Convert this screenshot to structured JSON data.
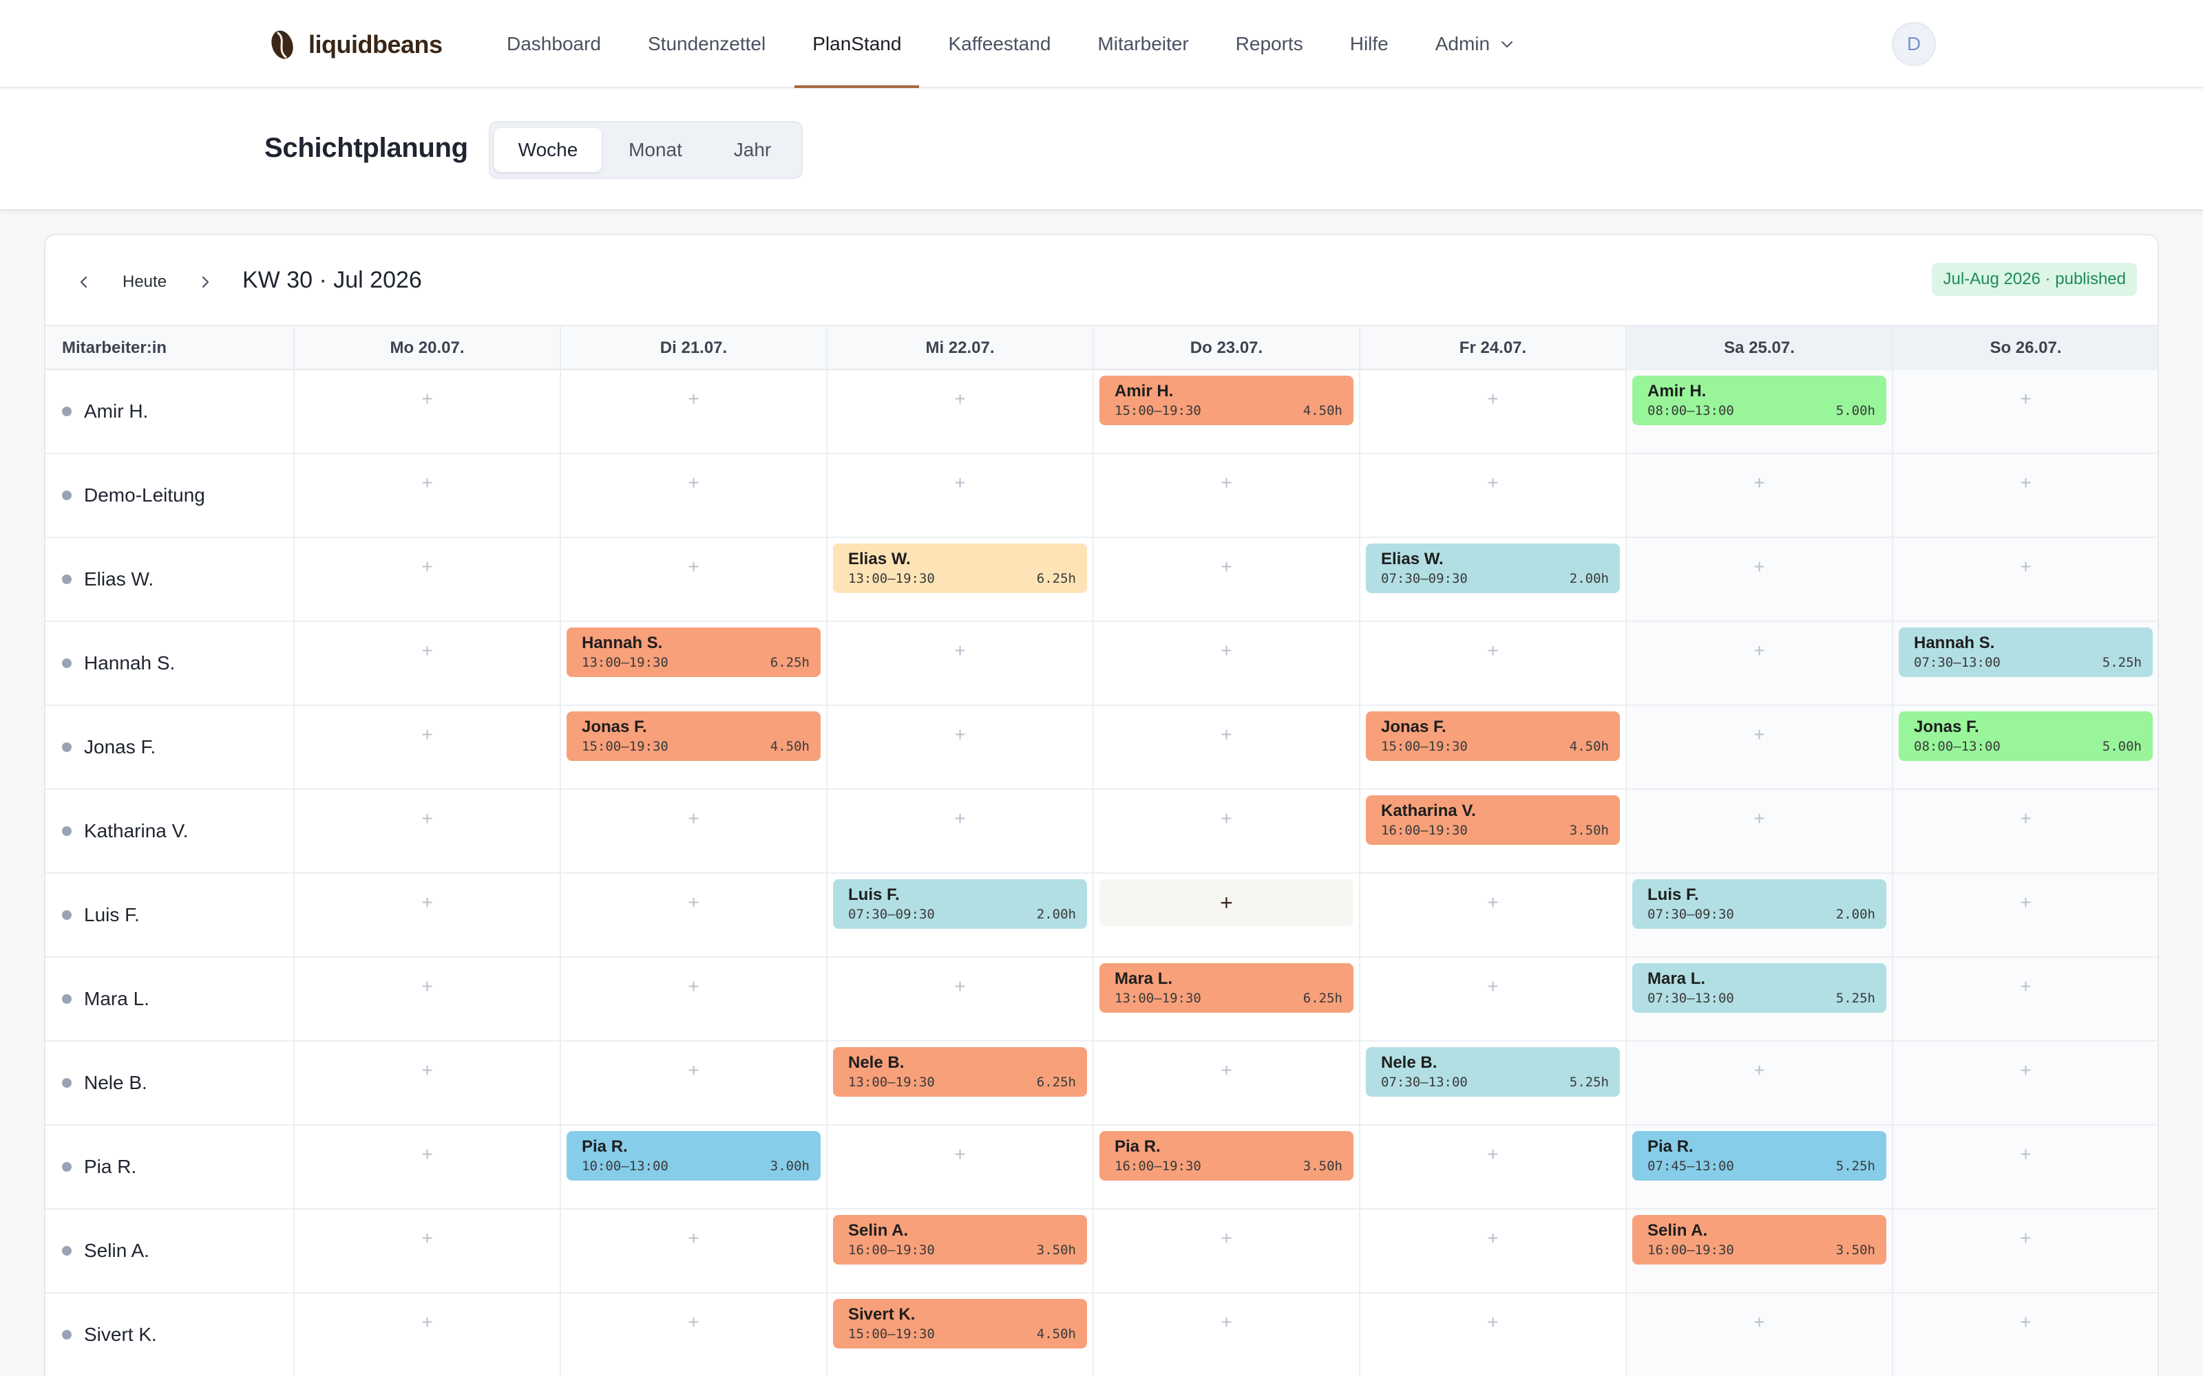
{
  "app": {
    "brand": "liquidbeans"
  },
  "nav": {
    "items": [
      {
        "label": "Dashboard",
        "active": false
      },
      {
        "label": "Stundenzettel",
        "active": false
      },
      {
        "label": "PlanStand",
        "active": true
      },
      {
        "label": "Kaffeestand",
        "active": false
      },
      {
        "label": "Mitarbeiter",
        "active": false
      },
      {
        "label": "Reports",
        "active": false
      },
      {
        "label": "Hilfe",
        "active": false
      },
      {
        "label": "Admin",
        "active": false,
        "dropdown": true
      }
    ],
    "avatar_initial": "D"
  },
  "page": {
    "title": "Schichtplanung",
    "views": [
      "Woche",
      "Monat",
      "Jahr"
    ],
    "active_view": "Woche"
  },
  "toolbar": {
    "today_label": "Heute",
    "week_label": "KW 30 · Jul 2026",
    "plan_status": "Jul-Aug 2026 · published"
  },
  "colors": {
    "orange": "#f7a07a",
    "cream": "#fde3b6",
    "teal": "#b2dfe3",
    "green": "#98f59a",
    "blue": "#86cde9",
    "accent": "#a66a44"
  },
  "grid": {
    "employee_header": "Mitarbeiter:in",
    "days": [
      {
        "label": "Mo 20.07.",
        "weekend": false
      },
      {
        "label": "Di 21.07.",
        "weekend": false
      },
      {
        "label": "Mi 22.07.",
        "weekend": false
      },
      {
        "label": "Do 23.07.",
        "weekend": false
      },
      {
        "label": "Fr 24.07.",
        "weekend": false
      },
      {
        "label": "Sa 25.07.",
        "weekend": true
      },
      {
        "label": "So 26.07.",
        "weekend": true
      }
    ],
    "hover_cell": {
      "employee": "Luis F.",
      "day": 3
    },
    "employees": [
      {
        "name": "Amir H.",
        "shifts": [
          {
            "day": 3,
            "label": "Amir H.",
            "time": "15:00–19:30",
            "hours": "4.50h",
            "color": "orange"
          },
          {
            "day": 5,
            "label": "Amir H.",
            "time": "08:00–13:00",
            "hours": "5.00h",
            "color": "green"
          }
        ]
      },
      {
        "name": "Demo-Leitung",
        "shifts": []
      },
      {
        "name": "Elias W.",
        "shifts": [
          {
            "day": 2,
            "label": "Elias W.",
            "time": "13:00–19:30",
            "hours": "6.25h",
            "color": "cream"
          },
          {
            "day": 4,
            "label": "Elias W.",
            "time": "07:30–09:30",
            "hours": "2.00h",
            "color": "teal"
          }
        ]
      },
      {
        "name": "Hannah S.",
        "shifts": [
          {
            "day": 1,
            "label": "Hannah S.",
            "time": "13:00–19:30",
            "hours": "6.25h",
            "color": "orange"
          },
          {
            "day": 6,
            "label": "Hannah S.",
            "time": "07:30–13:00",
            "hours": "5.25h",
            "color": "teal"
          }
        ]
      },
      {
        "name": "Jonas F.",
        "shifts": [
          {
            "day": 1,
            "label": "Jonas F.",
            "time": "15:00–19:30",
            "hours": "4.50h",
            "color": "orange"
          },
          {
            "day": 4,
            "label": "Jonas F.",
            "time": "15:00–19:30",
            "hours": "4.50h",
            "color": "orange"
          },
          {
            "day": 6,
            "label": "Jonas F.",
            "time": "08:00–13:00",
            "hours": "5.00h",
            "color": "green"
          }
        ]
      },
      {
        "name": "Katharina V.",
        "shifts": [
          {
            "day": 4,
            "label": "Katharina V.",
            "time": "16:00–19:30",
            "hours": "3.50h",
            "color": "orange"
          }
        ]
      },
      {
        "name": "Luis F.",
        "shifts": [
          {
            "day": 2,
            "label": "Luis F.",
            "time": "07:30–09:30",
            "hours": "2.00h",
            "color": "teal"
          },
          {
            "day": 5,
            "label": "Luis F.",
            "time": "07:30–09:30",
            "hours": "2.00h",
            "color": "teal"
          }
        ]
      },
      {
        "name": "Mara L.",
        "shifts": [
          {
            "day": 3,
            "label": "Mara L.",
            "time": "13:00–19:30",
            "hours": "6.25h",
            "color": "orange"
          },
          {
            "day": 5,
            "label": "Mara L.",
            "time": "07:30–13:00",
            "hours": "5.25h",
            "color": "teal"
          }
        ]
      },
      {
        "name": "Nele B.",
        "shifts": [
          {
            "day": 2,
            "label": "Nele B.",
            "time": "13:00–19:30",
            "hours": "6.25h",
            "color": "orange"
          },
          {
            "day": 4,
            "label": "Nele B.",
            "time": "07:30–13:00",
            "hours": "5.25h",
            "color": "teal"
          }
        ]
      },
      {
        "name": "Pia R.",
        "shifts": [
          {
            "day": 1,
            "label": "Pia R.",
            "time": "10:00–13:00",
            "hours": "3.00h",
            "color": "blue"
          },
          {
            "day": 3,
            "label": "Pia R.",
            "time": "16:00–19:30",
            "hours": "3.50h",
            "color": "orange"
          },
          {
            "day": 5,
            "label": "Pia R.",
            "time": "07:45–13:00",
            "hours": "5.25h",
            "color": "blue"
          }
        ]
      },
      {
        "name": "Selin A.",
        "shifts": [
          {
            "day": 2,
            "label": "Selin A.",
            "time": "16:00–19:30",
            "hours": "3.50h",
            "color": "orange"
          },
          {
            "day": 5,
            "label": "Selin A.",
            "time": "16:00–19:30",
            "hours": "3.50h",
            "color": "orange"
          }
        ]
      },
      {
        "name": "Sivert K.",
        "shifts": [
          {
            "day": 2,
            "label": "Sivert K.",
            "time": "15:00–19:30",
            "hours": "4.50h",
            "color": "orange"
          }
        ]
      }
    ]
  }
}
